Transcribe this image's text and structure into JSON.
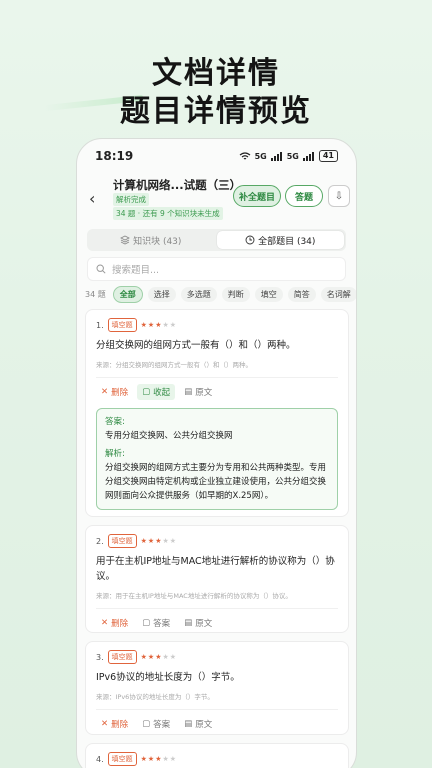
{
  "promo": {
    "line1": "文档详情",
    "line2": "题目详情预览"
  },
  "status_bar": {
    "time": "18:19",
    "network1": "5G",
    "network2": "5G",
    "battery": "41"
  },
  "header": {
    "back": "‹",
    "title": "计算机网络...试题（三）",
    "status": "解析完成",
    "progress": "34 题 · 还有 9 个知识块未生成",
    "btn_fill": "补全题目",
    "btn_answer": "答题",
    "btn_download": "⇩"
  },
  "tabs": [
    {
      "label": "知识块 (43)",
      "icon": "layers-icon"
    },
    {
      "label": "全部题目 (34)",
      "icon": "clock-icon"
    }
  ],
  "search": {
    "placeholder": "搜索题目..."
  },
  "filters": {
    "count": "34 题",
    "chips": [
      "全部",
      "选择",
      "多选题",
      "判断",
      "填空",
      "简答",
      "名词解"
    ]
  },
  "questions": [
    {
      "num": "1.",
      "type": "填空题",
      "text": "分组交换网的组网方式一般有（）和（）两种。",
      "source": "来源：分组交换网的组网方式一般有（）和（）两种。",
      "actions": [
        "删除",
        "收起",
        "原文"
      ],
      "answer_label": "答案:",
      "answer": "专用分组交换网、公共分组交换网",
      "analysis_label": "解析:",
      "analysis": "分组交换网的组网方式主要分为专用和公共两种类型。专用分组交换网由特定机构或企业独立建设使用，公共分组交换网则面向公众提供服务（如早期的X.25网）。"
    },
    {
      "num": "2.",
      "type": "填空题",
      "text": "用于在主机IP地址与MAC地址进行解析的协议称为（）协议。",
      "source": "来源：用于在主机IP地址与MAC地址进行解析的协议称为（）协议。",
      "actions": [
        "删除",
        "答案",
        "原文"
      ]
    },
    {
      "num": "3.",
      "type": "填空题",
      "text": "IPv6协议的地址长度为（）字节。",
      "source": "来源：IPv6协议的地址长度为（）字节。",
      "actions": [
        "删除",
        "答案",
        "原文"
      ]
    },
    {
      "num": "4.",
      "type": "填空题"
    }
  ],
  "colors": {
    "accent": "#2f8a43",
    "danger": "#e0643c",
    "bg": "#e6f4e8"
  }
}
